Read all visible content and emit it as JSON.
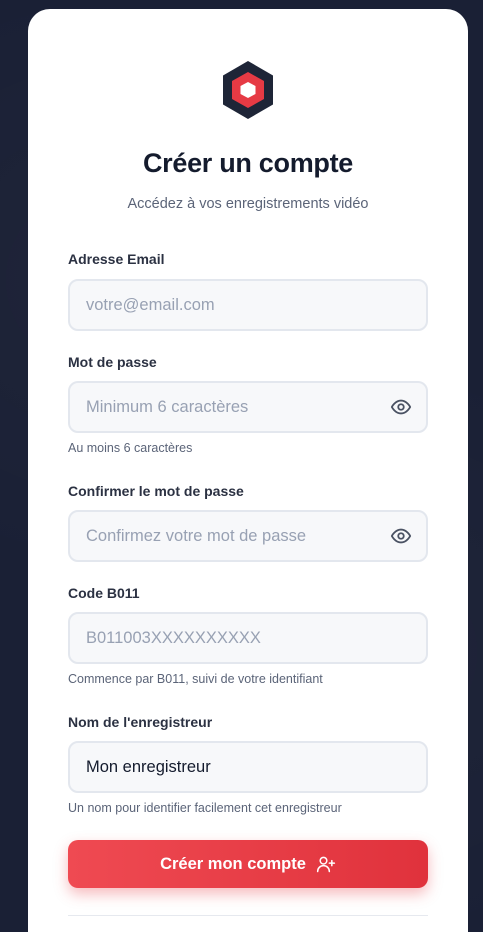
{
  "header": {
    "title": "Créer un compte",
    "subtitle": "Accédez à vos enregistrements vidéo",
    "logo_icon": "hexagon-logo-icon"
  },
  "form": {
    "email": {
      "label": "Adresse Email",
      "placeholder": "votre@email.com",
      "value": ""
    },
    "password": {
      "label": "Mot de passe",
      "placeholder": "Minimum 6 caractères",
      "value": "",
      "hint": "Au moins 6 caractères",
      "toggle_icon": "eye-icon"
    },
    "confirm_password": {
      "label": "Confirmer le mot de passe",
      "placeholder": "Confirmez votre mot de passe",
      "value": "",
      "toggle_icon": "eye-icon"
    },
    "code": {
      "label": "Code B011",
      "placeholder": "B011003XXXXXXXXXX",
      "value": "",
      "hint": "Commence par B011, suivi de votre identifiant"
    },
    "recorder_name": {
      "label": "Nom de l'enregistreur",
      "placeholder": "",
      "value": "Mon enregistreur",
      "hint": "Un nom pour identifier facilement cet enregistreur"
    },
    "submit": {
      "label": "Créer mon compte",
      "icon": "user-plus-icon"
    }
  },
  "colors": {
    "background": "#1a2035",
    "card": "#ffffff",
    "accent": "#e63a44",
    "logo_dark": "#1e2537"
  }
}
